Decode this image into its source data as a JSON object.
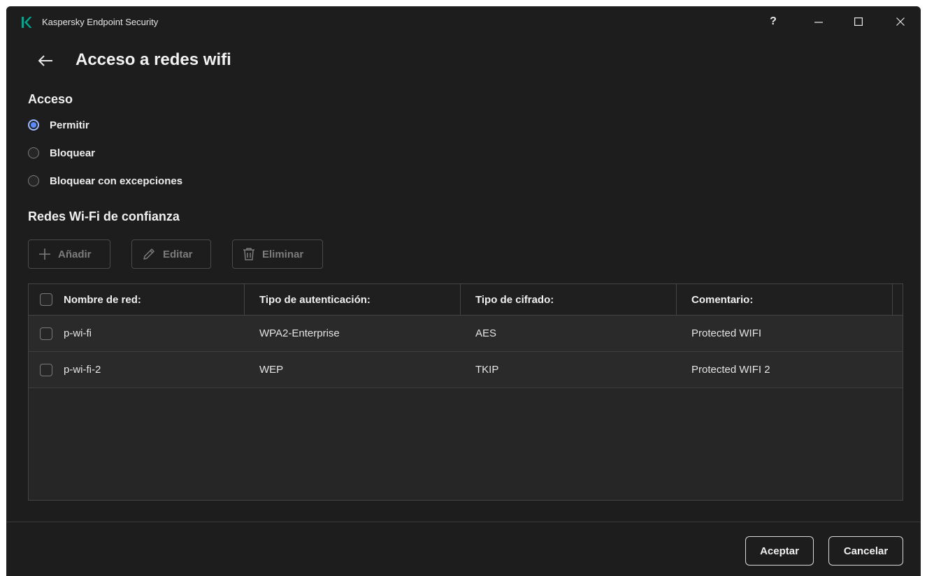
{
  "window": {
    "title": "Kaspersky Endpoint Security",
    "help_label": "?",
    "accent": "#00a88e"
  },
  "header": {
    "title": "Acceso a redes wifi"
  },
  "access": {
    "title": "Acceso",
    "options": [
      {
        "label": "Permitir",
        "selected": true
      },
      {
        "label": "Bloquear",
        "selected": false
      },
      {
        "label": "Bloquear con excepciones",
        "selected": false
      }
    ]
  },
  "trusted": {
    "title": "Redes Wi-Fi de confianza",
    "toolbar": {
      "add_label": "Añadir",
      "edit_label": "Editar",
      "delete_label": "Eliminar"
    },
    "columns": [
      "Nombre de red:",
      "Tipo de autenticación:",
      "Tipo de cifrado:",
      "Comentario:"
    ],
    "rows": [
      {
        "name": "p-wi-fi",
        "auth": "WPA2-Enterprise",
        "cipher": "AES",
        "comment": "Protected WIFI"
      },
      {
        "name": "p-wi-fi-2",
        "auth": "WEP",
        "cipher": "TKIP",
        "comment": "Protected WIFI 2"
      }
    ]
  },
  "footer": {
    "ok_label": "Aceptar",
    "cancel_label": "Cancelar"
  }
}
